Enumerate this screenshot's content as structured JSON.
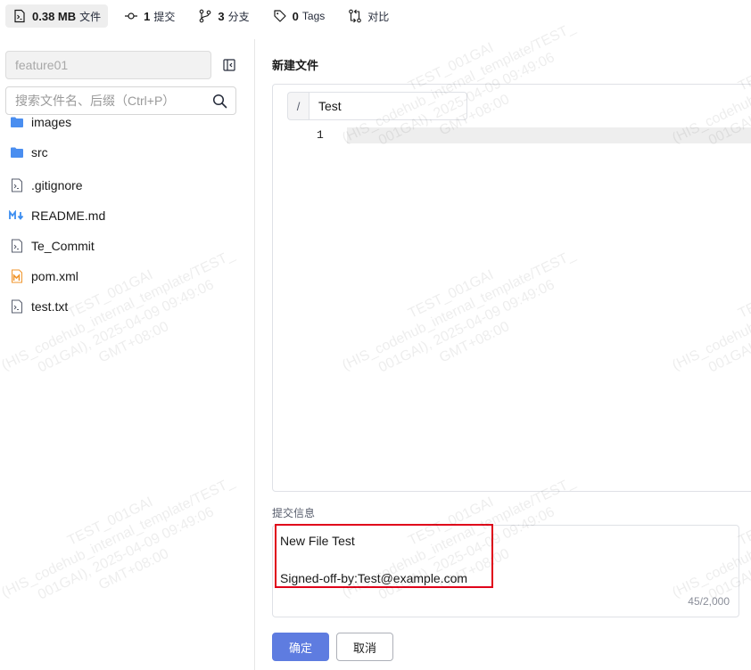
{
  "stats": [
    {
      "icon": "file-size-icon",
      "value": "0.38 MB",
      "label": "文件"
    },
    {
      "icon": "commit-icon",
      "value": "1",
      "label": "提交"
    },
    {
      "icon": "branch-icon",
      "value": "3",
      "label": "分支"
    },
    {
      "icon": "tag-icon",
      "value": "0",
      "label": "Tags"
    },
    {
      "icon": "compare-icon",
      "value": "",
      "label": "对比"
    }
  ],
  "sidebar": {
    "branch": "feature01",
    "search_placeholder": "搜索文件名、后缀（Ctrl+P）",
    "files": [
      {
        "name": "images",
        "type": "folder"
      },
      {
        "name": "src",
        "type": "folder"
      },
      {
        "name": ".gitignore",
        "type": "file"
      },
      {
        "name": "README.md",
        "type": "markdown"
      },
      {
        "name": "Te_Commit",
        "type": "file"
      },
      {
        "name": "pom.xml",
        "type": "maven"
      },
      {
        "name": "test.txt",
        "type": "file"
      }
    ]
  },
  "editor": {
    "title": "新建文件",
    "path_separator": "/",
    "file_name": "Test",
    "line_number": "1"
  },
  "commit": {
    "label": "提交信息",
    "message": "New File Test\n\nSigned-off-by:Test@example.com",
    "counter": "45/2,000",
    "ok_label": "确定",
    "cancel_label": "取消"
  },
  "watermark": "TEST_001GAI\n(HIS_codehub_internal_template/TEST_\n001GAI), 2025-04-09 09:49:06\nGMT+08:00",
  "colors": {
    "primary": "#5e7ce0",
    "highlight": "#e0001a",
    "folder": "#4a8ef0",
    "maven": "#f0952b"
  }
}
